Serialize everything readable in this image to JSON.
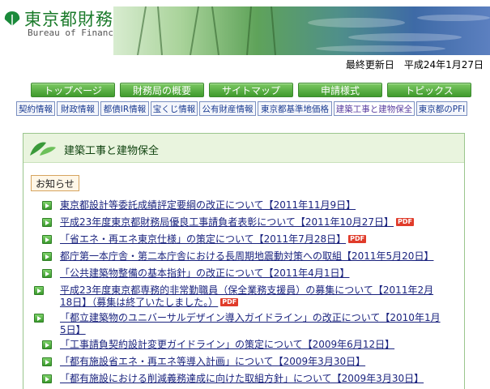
{
  "header": {
    "logo_jp": "東京都財務局",
    "logo_en": "Bureau of Finance",
    "last_updated": "最終更新日　平成24年1月27日"
  },
  "nav": [
    "トップページ",
    "財務局の概要",
    "サイトマップ",
    "申請様式",
    "トピックス"
  ],
  "subnav": [
    "契約情報",
    "財政情報",
    "都債IR情報",
    "宝くじ情報",
    "公有財産情報",
    "東京都基準地価格",
    "建築工事と建物保全",
    "東京都のPFI"
  ],
  "section": {
    "title": "建築工事と建物保全",
    "notice_label": "お知らせ"
  },
  "news": [
    {
      "text": "東京都設計等委託成績評定要綱の改正について【2011年11月9日】",
      "pdf": ""
    },
    {
      "text": "平成23年度東京都財務局優良工事請負者表彰について【2011年10月27日】",
      "pdf": "PDF"
    },
    {
      "text": "「省エネ・再エネ東京仕様」の策定について【2011年7月28日】",
      "pdf": "PDF"
    },
    {
      "text": "都庁第一本庁舎・第二本庁舎における長周期地震動対策への取組【2011年5月20日】",
      "pdf": ""
    },
    {
      "text": "「公共建築物整備の基本指針」の改正について【2011年4月1日】",
      "pdf": ""
    },
    {
      "text": "平成23年度東京都専務的非常勤職員（保全業務支援員）の募集について【2011年2月18日】（募集は終了いたしました。）",
      "pdf": "PDF"
    },
    {
      "text": "「都立建築物のユニバーサルデザイン導入ガイドライン」の改正について【2010年1月5日】",
      "pdf": ""
    },
    {
      "text": "「工事請負契約設計変更ガイドライン」の策定について【2009年6月12日】",
      "pdf": ""
    },
    {
      "text": "「都有施設省エネ・再エネ等導入計画」について【2009年3月30日】",
      "pdf": ""
    },
    {
      "text": "「都有施設における削減義務達成に向けた取組方針」について【2009年3月30日】",
      "pdf": ""
    }
  ]
}
